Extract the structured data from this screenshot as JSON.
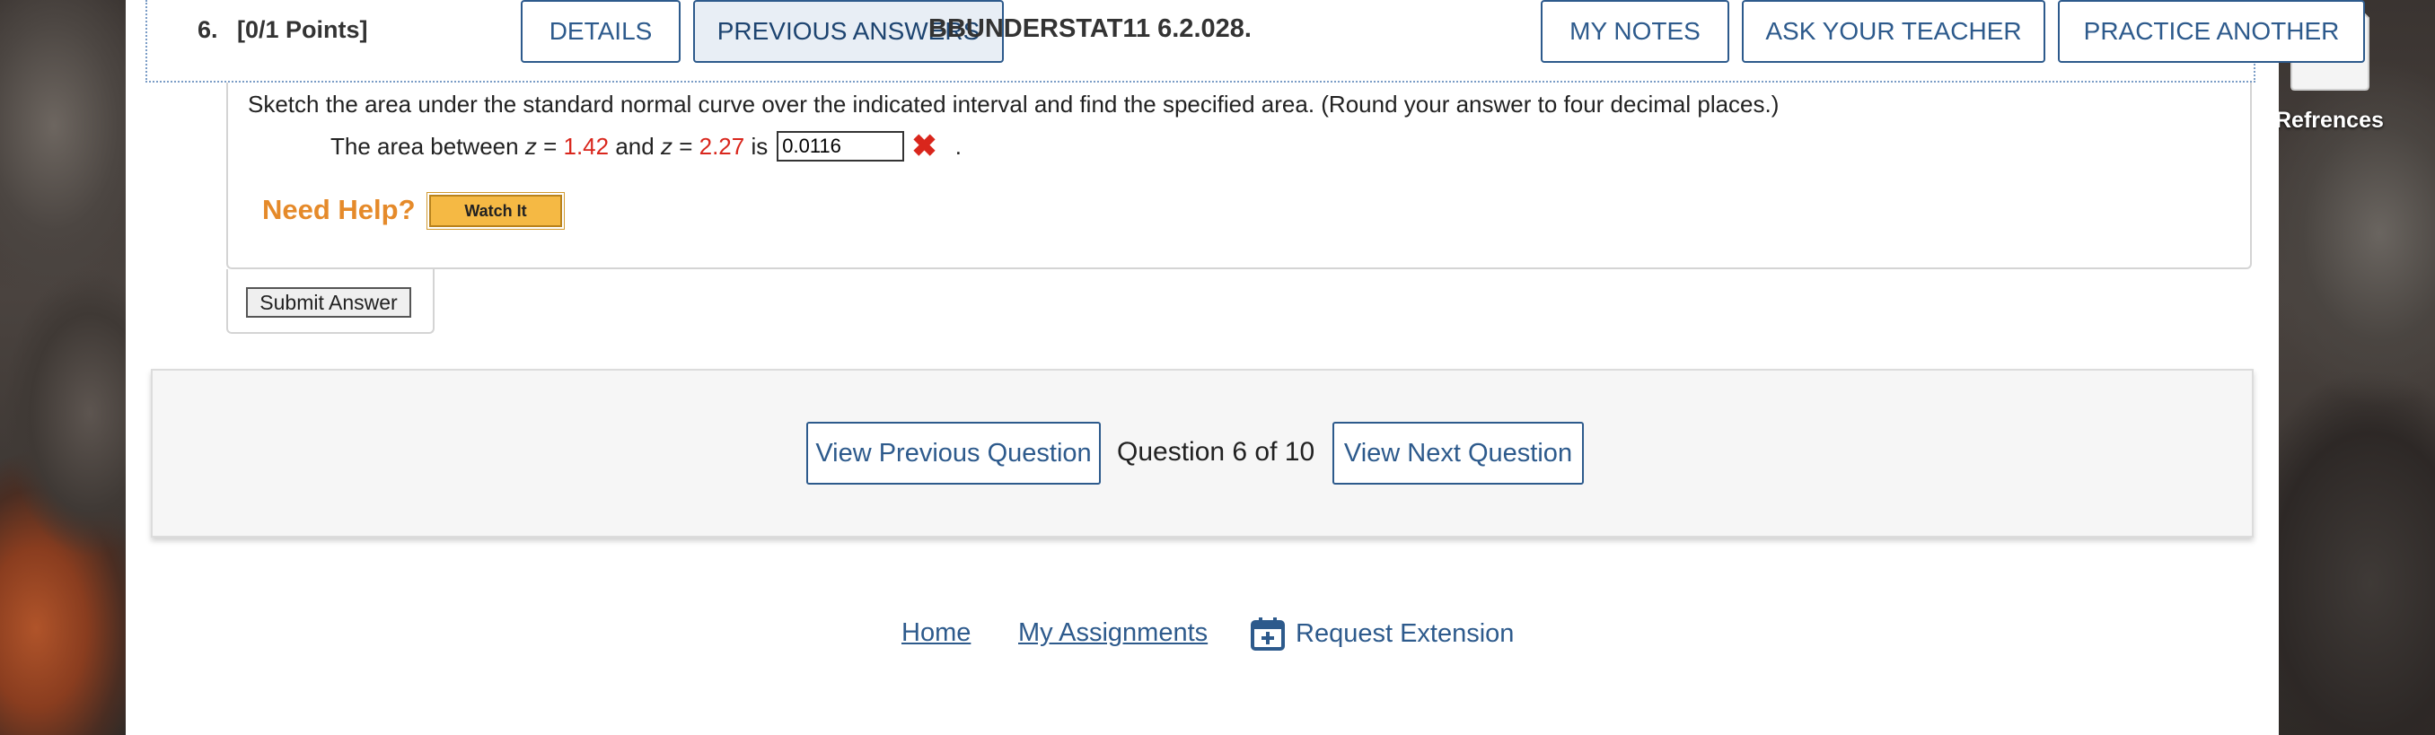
{
  "header": {
    "question_number": "6.",
    "points": "[0/1 Points]",
    "details_label": "DETAILS",
    "previous_answers_label": "PREVIOUS ANSWERS",
    "question_code": "BBUNDERSTAT11 6.2.028.",
    "my_notes_label": "MY NOTES",
    "ask_teacher_label": "ASK YOUR TEACHER",
    "practice_another_label": "PRACTICE ANOTHER"
  },
  "question": {
    "prompt": "Sketch the area under the standard normal curve over the indicated interval and find the specified area. (Round your answer to four decimal places.)",
    "line_prefix": "The area between",
    "var1": "z",
    "eq": "=",
    "z1": "1.42",
    "and": "and",
    "var2": "z",
    "z2": "2.27",
    "is": "is",
    "answer_value": "0.0116",
    "answer_status_icon": "red-x-icon",
    "trailing": "."
  },
  "help": {
    "need_help_label": "Need Help?",
    "watch_it_label": "Watch It"
  },
  "submit_label": "Submit Answer",
  "navigation": {
    "prev_label": "View Previous Question",
    "counter": "Question 6 of 10",
    "next_label": "View Next Question"
  },
  "footer": {
    "home": "Home",
    "assignments": "My Assignments",
    "extension": "Request Extension",
    "extension_icon": "calendar-plus-icon"
  },
  "desktop": {
    "file_label": "Refrences",
    "file_icon": "document-icon"
  },
  "colors": {
    "link_blue": "#2d5a8c",
    "value_red": "#d9261c",
    "help_orange": "#e58a2a",
    "watch_it_yellow": "#f5b944"
  }
}
